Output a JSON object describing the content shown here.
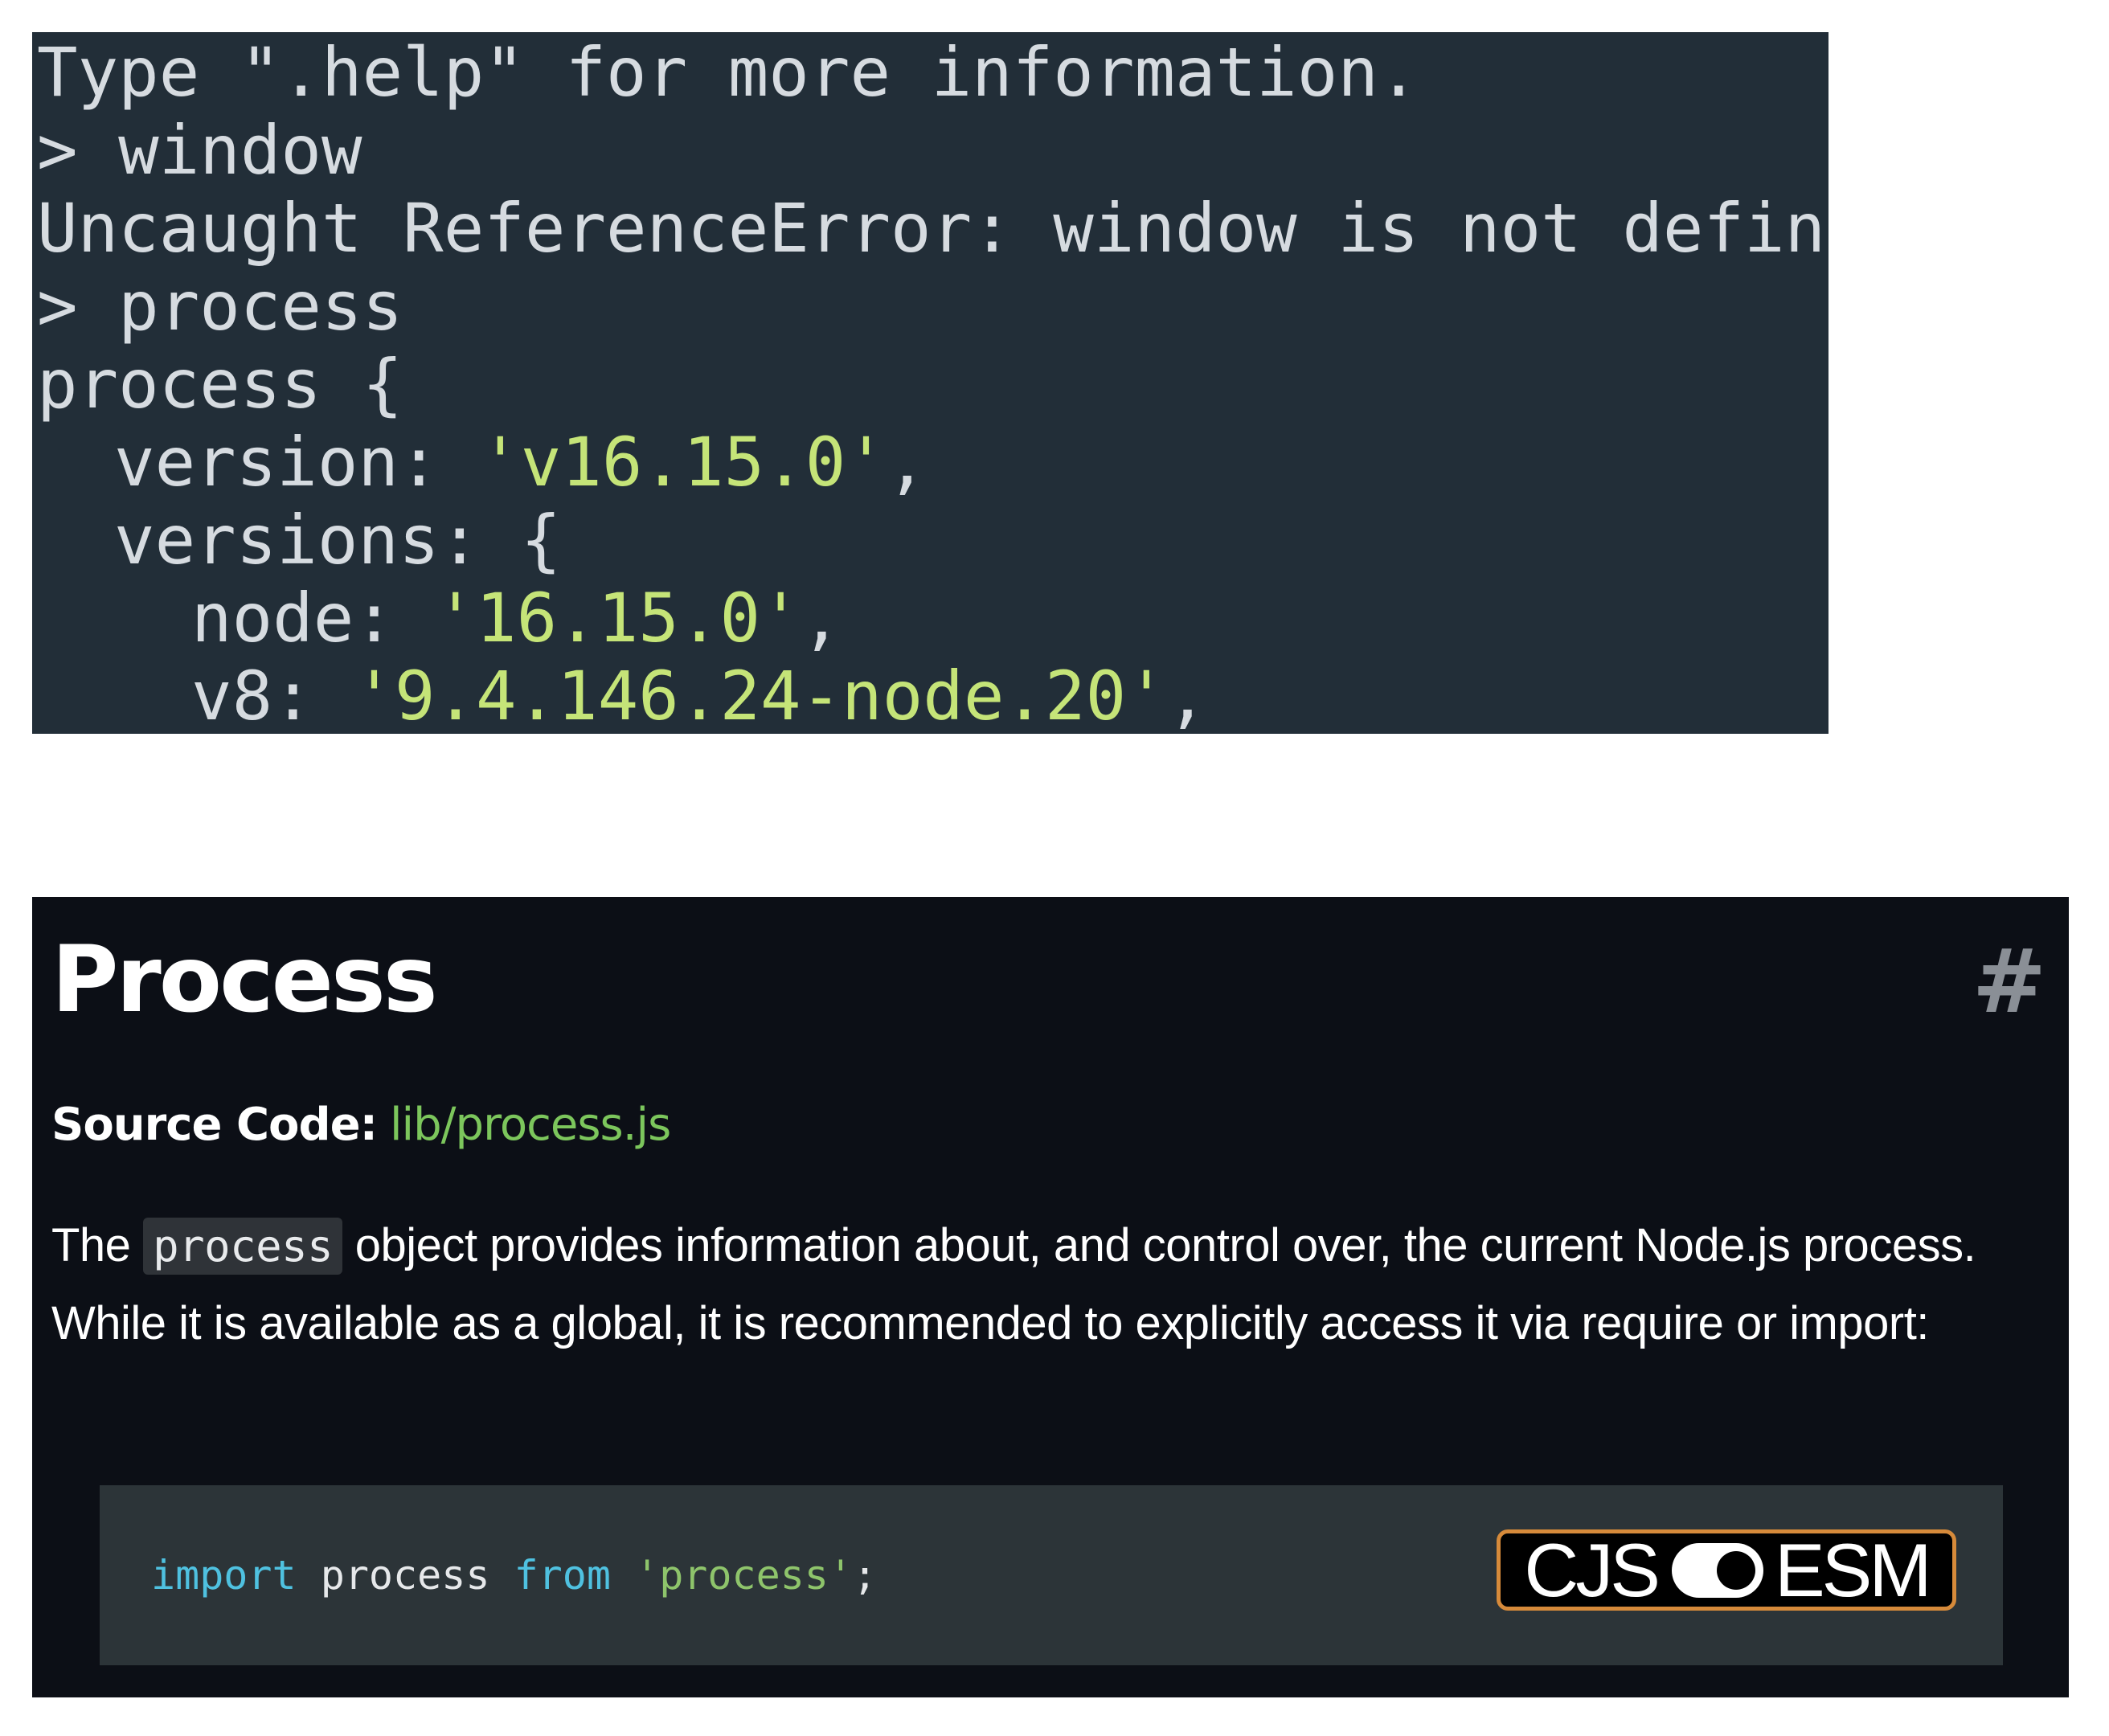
{
  "terminal": {
    "lines": [
      "Type \".help\" for more information.",
      "> window",
      "Uncaught ReferenceError: window is not defined",
      "> process",
      "process {"
    ],
    "version_key": "version: ",
    "version_value": "'v16.15.0'",
    "version_comma": ",",
    "versions_key": "versions: {",
    "node_key": "node: ",
    "node_value": "'16.15.0'",
    "node_comma": ",",
    "v8_key": "v8: ",
    "v8_value": "'9.4.146.24-node.20'",
    "v8_comma": ","
  },
  "docs": {
    "title": "Process",
    "anchor": "#",
    "source_label": "Source Code:",
    "source_link": "lib/process.js",
    "para_before": "The",
    "para_code": "process",
    "para_after": "object provides information about, and control over, the current Node.js process. While it is available as a global, it is recommended to explicitly access it via require or import:",
    "code": {
      "kw_import": "import",
      "ident": " process ",
      "kw_from": "from",
      "space": " ",
      "str": "'process'",
      "semi": ";"
    },
    "toggle": {
      "left_label": "CJS",
      "right_label": "ESM",
      "selected": "ESM"
    }
  },
  "colors": {
    "terminal_bg": "#222e38",
    "terminal_string": "#c5e478",
    "docs_bg": "#0c0f16",
    "link_green": "#7cc65c",
    "code_bg": "#2c3438",
    "keyword_blue": "#4fc1e0",
    "toggle_border": "#d68a3a"
  }
}
